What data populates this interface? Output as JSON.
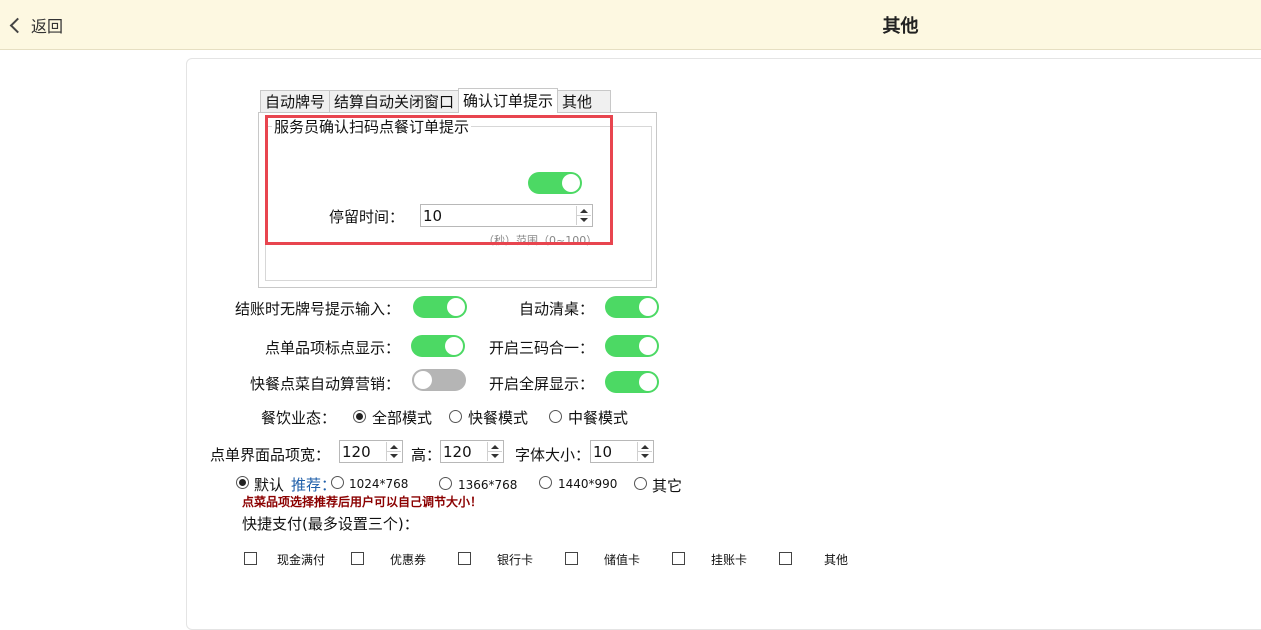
{
  "header": {
    "back_label": "返回",
    "title": "其他"
  },
  "tabs": [
    {
      "label": "自动牌号"
    },
    {
      "label": "结算自动关闭窗口"
    },
    {
      "label": "确认订单提示",
      "active": true
    },
    {
      "label": "其他"
    }
  ],
  "confirm_group": {
    "title": "服务员确认扫码点餐订单提示",
    "enabled": true,
    "stay_label": "停留时间：",
    "stay_value": "10",
    "stay_hint": "（秒）范围（0~100）"
  },
  "switches": {
    "no_number_prompt": {
      "label": "结账时无牌号提示输入：",
      "on": true
    },
    "auto_clear_table": {
      "label": "自动清桌：",
      "on": true
    },
    "item_dot_display": {
      "label": "点单品项标点显示：",
      "on": true
    },
    "three_in_one": {
      "label": "开启三码合一：",
      "on": true
    },
    "fast_auto_marketing": {
      "label": "快餐点菜自动算营销：",
      "on": false
    },
    "fullscreen": {
      "label": "开启全屏显示：",
      "on": true
    }
  },
  "mode": {
    "label": "餐饮业态：",
    "options": [
      "全部模式",
      "快餐模式",
      "中餐模式"
    ],
    "selected": "全部模式"
  },
  "size": {
    "width_label": "点单界面品项宽：",
    "width_value": "120",
    "height_label": "高：",
    "height_value": "120",
    "font_label": "字体大小：",
    "font_value": "10"
  },
  "resolution": {
    "default_label": "默认",
    "recommend_label": "推荐：",
    "options": [
      "1024*768",
      "1366*768",
      "1440*990",
      "其它"
    ],
    "selected": "默认",
    "warning": "点菜品项选择推荐后用户可以自己调节大小！"
  },
  "quick_pay": {
    "label": "快捷支付(最多设置三个)：",
    "options": [
      "现金满付",
      "优惠券",
      "银行卡",
      "储值卡",
      "挂账卡",
      "其他"
    ]
  },
  "colors": {
    "toggle_on": "#4cd964",
    "toggle_off": "#b5b5b5",
    "highlight": "#e8454f",
    "header_bg": "#fdf8e1",
    "warning": "#8b0000",
    "recommend": "#1f5faa"
  }
}
